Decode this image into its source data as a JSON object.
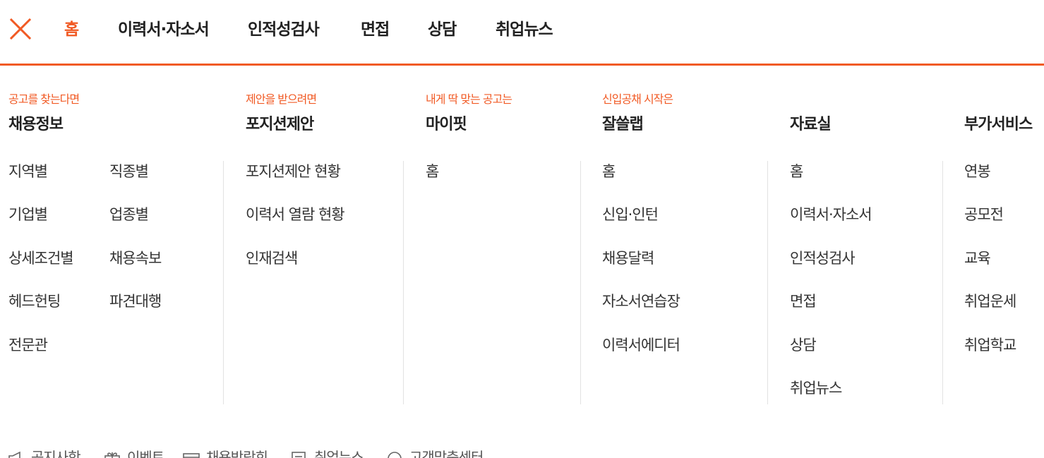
{
  "top_nav": {
    "close_label": "close",
    "items": [
      "홈",
      "이력서·자소서",
      "인적성검사",
      "면접",
      "상담",
      "취업뉴스"
    ],
    "active_index": 0
  },
  "colors": {
    "accent": "#f15a24",
    "text": "#222222",
    "divider": "#e2e2e2"
  },
  "sections": [
    {
      "tagline": "공고를 찾는다면",
      "title": "채용정보",
      "links": [
        "지역별",
        "직종별",
        "기업별",
        "업종별",
        "상세조건별",
        "채용속보",
        "헤드헌팅",
        "파견대행",
        "전문관"
      ]
    },
    {
      "tagline": "제안을 받으려면",
      "title": "포지션제안",
      "links": [
        "포지션제안 현황",
        "이력서 열람 현황",
        "인재검색"
      ]
    },
    {
      "tagline": "내게 딱 맞는 공고는",
      "title": "마이핏",
      "links": [
        "홈"
      ]
    },
    {
      "tagline": "신입공채 시작은",
      "title": "잘쓸랩",
      "links": [
        "홈",
        "신입·인턴",
        "채용달력",
        "자소서연습장",
        "이력서에디터"
      ]
    },
    {
      "tagline": "",
      "title": "자료실",
      "links": [
        "홈",
        "이력서·자소서",
        "인적성검사",
        "면접",
        "상담",
        "취업뉴스"
      ]
    },
    {
      "tagline": "",
      "title": "부가서비스",
      "links": [
        "연봉",
        "공모전",
        "교육",
        "취업운세",
        "취업학교"
      ]
    }
  ],
  "bottom_links": [
    {
      "label": "공지사항",
      "icon": "megaphone-icon"
    },
    {
      "label": "이벤트",
      "icon": "gift-icon"
    },
    {
      "label": "채용박람회",
      "icon": "calendar-icon"
    },
    {
      "label": "취업뉴스",
      "icon": "newspaper-icon"
    },
    {
      "label": "고객맞춤센터",
      "icon": "headset-icon"
    }
  ]
}
